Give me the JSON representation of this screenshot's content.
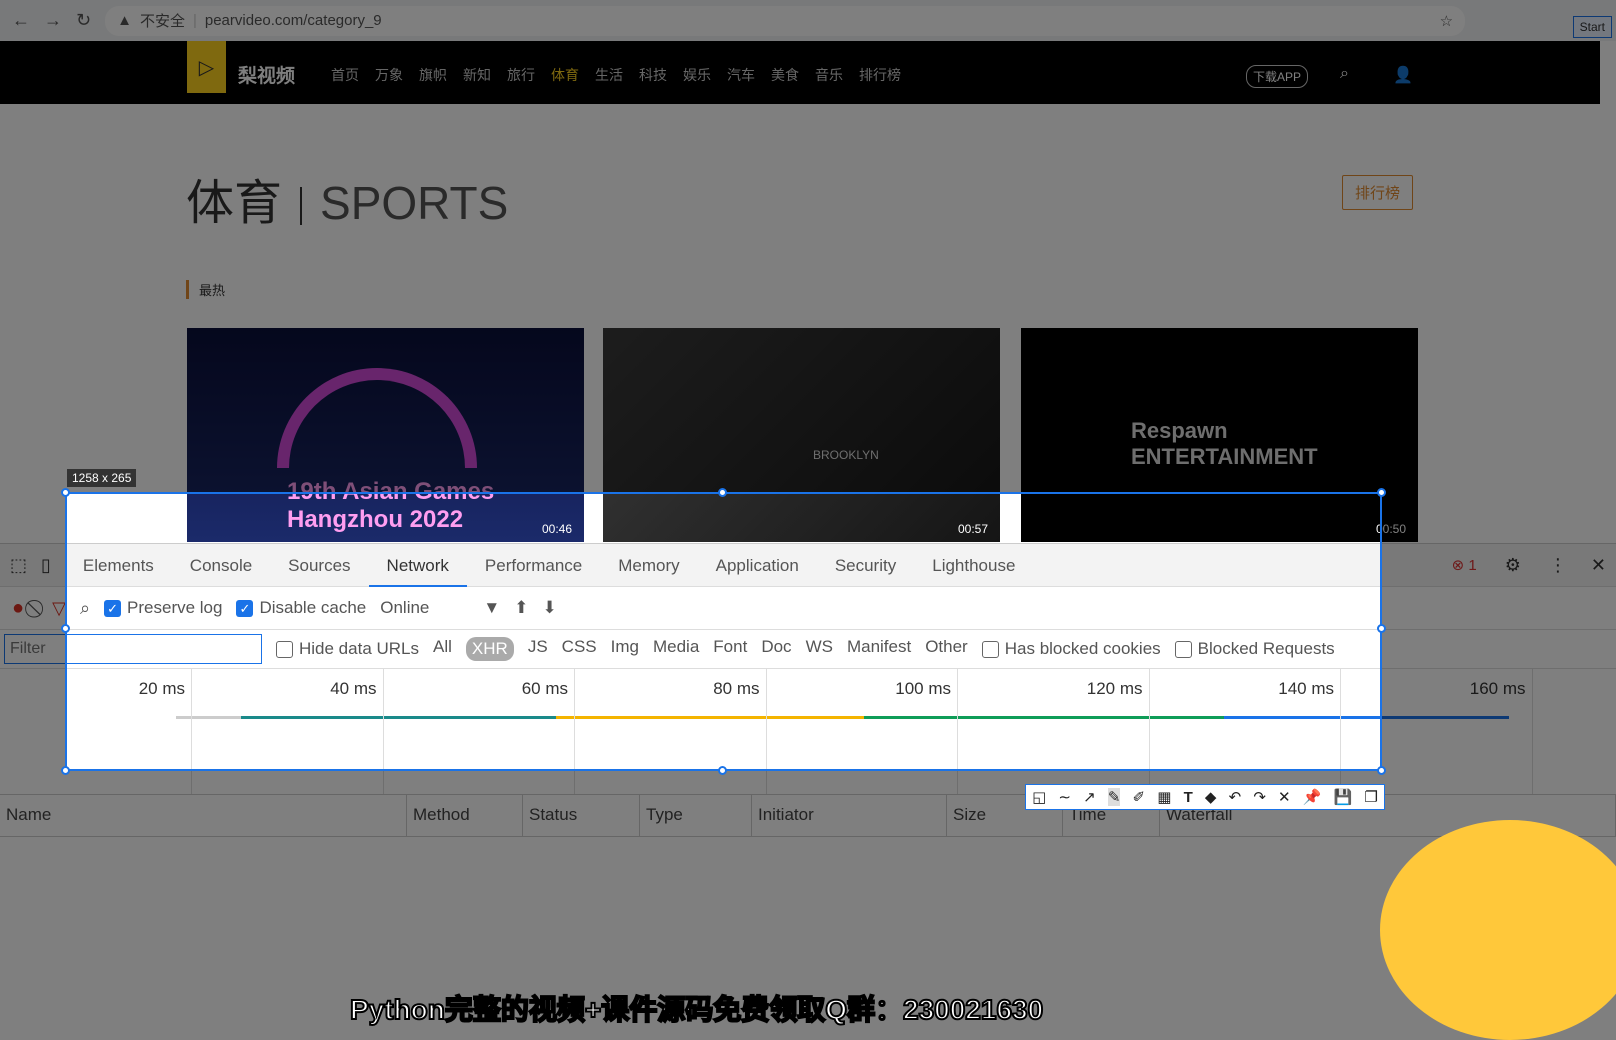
{
  "browser": {
    "insecure": "不安全",
    "url": "pearvideo.com/category_9",
    "start": "Start"
  },
  "site": {
    "brand": "梨视频",
    "nav": [
      "首页",
      "万象",
      "旗帜",
      "新知",
      "旅行",
      "体育",
      "生活",
      "科技",
      "娱乐",
      "汽车",
      "美食",
      "音乐",
      "排行榜"
    ],
    "active": "体育",
    "download": "下载APP",
    "title_cn": "体育",
    "title_en": "SPORTS",
    "rank_button": "排行榜",
    "section": "最热",
    "videos": [
      {
        "caption": "19th Asian Games Hangzhou 2022",
        "duration": "00:46"
      },
      {
        "caption": "BROOKLYN",
        "duration": "00:57"
      },
      {
        "caption": "Respawn ENTERTAINMENT",
        "duration": "00:50"
      }
    ]
  },
  "devtools": {
    "tabs": [
      "Elements",
      "Console",
      "Sources",
      "Network",
      "Performance",
      "Memory",
      "Application",
      "Security",
      "Lighthouse"
    ],
    "active_tab": "Network",
    "error_count": "1",
    "toolbar": {
      "preserve_log": "Preserve log",
      "disable_cache": "Disable cache",
      "throttle": "Online"
    },
    "filter": {
      "placeholder": "Filter",
      "hide_data_urls": "Hide data URLs",
      "types": [
        "All",
        "XHR",
        "JS",
        "CSS",
        "Img",
        "Media",
        "Font",
        "Doc",
        "WS",
        "Manifest",
        "Other"
      ],
      "active_type": "XHR",
      "blocked_cookies": "Has blocked cookies",
      "blocked_requests": "Blocked Requests"
    },
    "timeline_ticks": [
      "20 ms",
      "40 ms",
      "60 ms",
      "80 ms",
      "100 ms",
      "120 ms",
      "140 ms",
      "160 ms"
    ],
    "columns": [
      "Name",
      "Method",
      "Status",
      "Type",
      "Initiator",
      "Size",
      "Time",
      "Waterfall"
    ]
  },
  "screenshot_tool": {
    "selection_size": "1258 x 265"
  },
  "subtitle": "Python完整的视频+课件源码免费领取Q群：230021630"
}
